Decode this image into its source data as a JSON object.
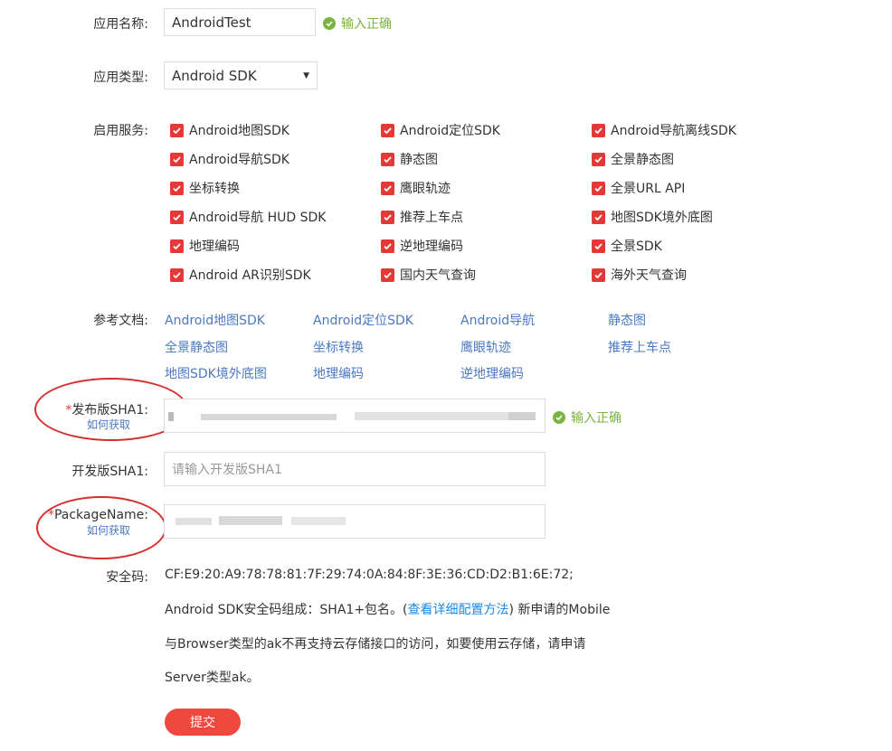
{
  "form": {
    "app_name": {
      "label": "应用名称:",
      "value": "AndroidTest",
      "status": "输入正确"
    },
    "app_type": {
      "label": "应用类型:",
      "value": "Android SDK"
    },
    "services": {
      "label": "启用服务:",
      "items": [
        "Android地图SDK",
        "Android定位SDK",
        "Android导航离线SDK",
        "Android导航SDK",
        "静态图",
        "全景静态图",
        "坐标转换",
        "鹰眼轨迹",
        "全景URL API",
        "Android导航 HUD SDK",
        "推荐上车点",
        "地图SDK境外底图",
        "地理编码",
        "逆地理编码",
        "全景SDK",
        "Android AR识别SDK",
        "国内天气查询",
        "海外天气查询"
      ]
    },
    "docs": {
      "label": "参考文档:",
      "items": [
        "Android地图SDK",
        "Android定位SDK",
        "Android导航",
        "静态图",
        "全景静态图",
        "坐标转换",
        "鹰眼轨迹",
        "推荐上车点",
        "地图SDK境外底图",
        "地理编码",
        "逆地理编码"
      ]
    },
    "release_sha1": {
      "required_mark": "*",
      "label": "发布版SHA1:",
      "howto": "如何获取",
      "status": "输入正确"
    },
    "debug_sha1": {
      "label": "开发版SHA1:",
      "placeholder": "请输入开发版SHA1"
    },
    "package_name": {
      "required_mark": "*",
      "label": "PackageName:",
      "howto": "如何获取"
    },
    "security": {
      "label": "安全码:",
      "code": "CF:E9:20:A9:78:78:81:7F:29:74:0A:84:8F:3E:36:CD:D2:B1:6E:72;",
      "note_part1": "Android SDK安全码组成：SHA1+包名。(",
      "note_link": "查看详细配置方法",
      "note_part2": ") 新申请的Mobile",
      "note_line2": "与Browser类型的ak不再支持云存储接口的访问，如要使用云存储，请申请",
      "note_line3": "Server类型ak。"
    },
    "submit_label": "提交"
  },
  "colors": {
    "accent": "#e53935",
    "ok": "#7cb342",
    "link": "#4a78c2",
    "button": "#f0483e"
  }
}
